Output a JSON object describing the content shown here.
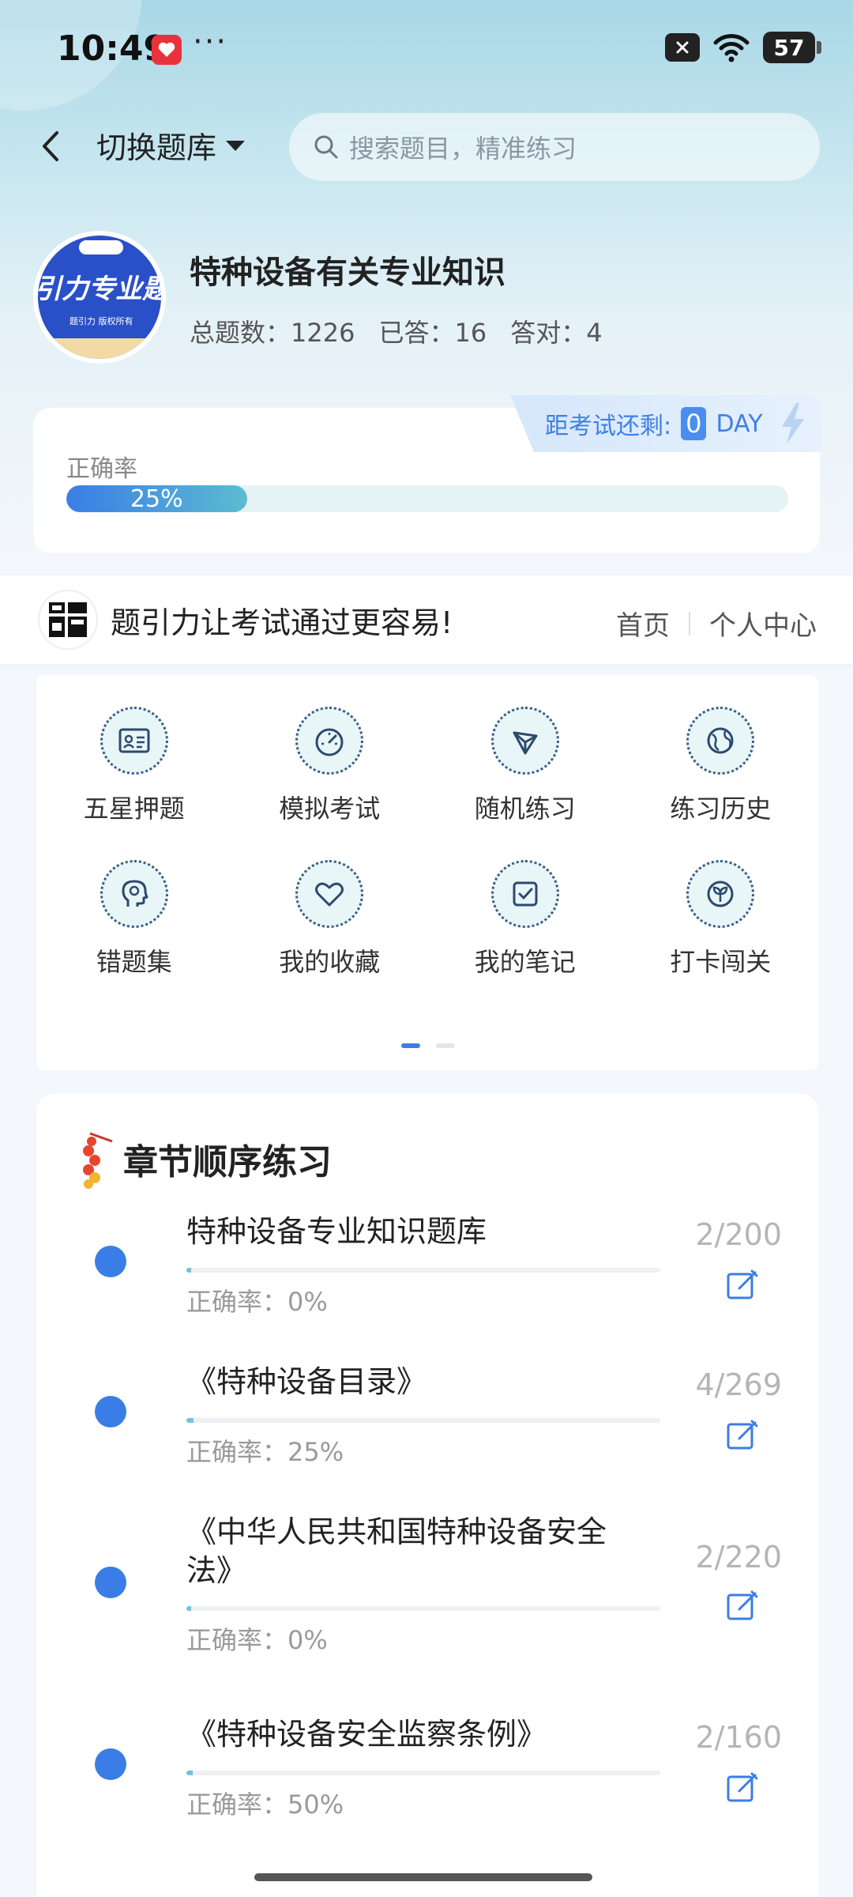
{
  "status_bar": {
    "time": "10:49",
    "dots": "···",
    "battery": "57"
  },
  "header": {
    "switch_label": "切换题库",
    "search_placeholder": "搜索题目，精准练习"
  },
  "bank": {
    "logo_text": "引力专业题",
    "logo_small": "题引力 版权所有",
    "title": "特种设备有关专业知识",
    "total_label": "总题数：",
    "total": "1226",
    "answered_label": "已答：",
    "answered": "16",
    "correct_label": "答对：",
    "correct": "4"
  },
  "accuracy": {
    "label": "正确率",
    "percent_text": "25%",
    "fill_fraction": 0.25,
    "countdown_label": "距考试还剩:",
    "countdown_value": "0",
    "countdown_unit": "DAY"
  },
  "slogan": {
    "logo_text": "题引力",
    "text": "题引力让考试通过更容易!",
    "home": "首页",
    "personal": "个人中心"
  },
  "grid": {
    "items": [
      {
        "label": "五星押题",
        "icon": "id-card-icon"
      },
      {
        "label": "模拟考试",
        "icon": "speedometer-icon"
      },
      {
        "label": "随机练习",
        "icon": "network-icon"
      },
      {
        "label": "练习历史",
        "icon": "globe-icon"
      },
      {
        "label": "错题集",
        "icon": "head-icon"
      },
      {
        "label": "我的收藏",
        "icon": "heart-icon"
      },
      {
        "label": "我的笔记",
        "icon": "check-note-icon"
      },
      {
        "label": "打卡闯关",
        "icon": "leaf-icon"
      }
    ]
  },
  "chapters": {
    "title": "章节顺序练习",
    "items": [
      {
        "name": "特种设备专业知识题库",
        "accuracy": "正确率：0%",
        "count": "2/200",
        "progress": 0.01
      },
      {
        "name": "《特种设备目录》",
        "accuracy": "正确率：25%",
        "count": "4/269",
        "progress": 0.015
      },
      {
        "name": "《中华人民共和国特种设备安全法》",
        "accuracy": "正确率：0%",
        "count": "2/220",
        "progress": 0.01
      },
      {
        "name": "《特种设备安全监察条例》",
        "accuracy": "正确率：50%",
        "count": "2/160",
        "progress": 0.013
      }
    ]
  },
  "colors": {
    "accent": "#3b7de6",
    "teal": "#5bbcd1"
  }
}
